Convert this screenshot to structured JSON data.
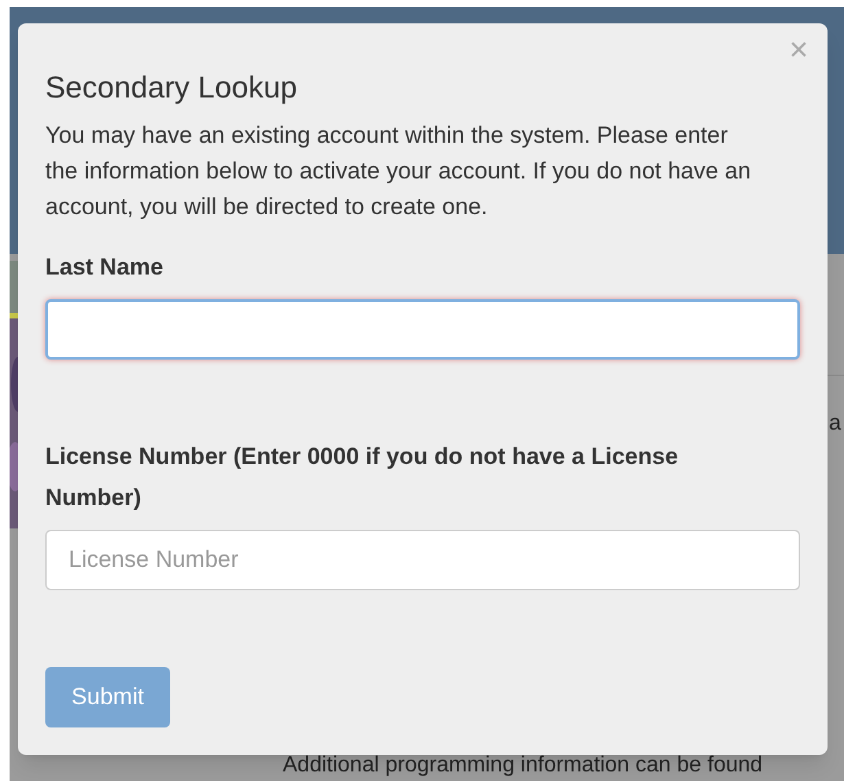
{
  "background_page": {
    "side_text": "a",
    "footer_text": "Additional programming information can be found"
  },
  "modal": {
    "title": "Secondary Lookup",
    "close": "×",
    "intro": "You may have an existing account within the system. Please enter the information below to activate your account. If you do not have an account, you will be directed to create one.",
    "fields": [
      {
        "label": "Last Name",
        "focused": true
      },
      {
        "label": "License Number (Enter 0000 if you do not have a License Number)",
        "placeholder": "License Number",
        "focused": false
      }
    ],
    "submit": {
      "label": "Submit",
      "disabled": true
    }
  }
}
